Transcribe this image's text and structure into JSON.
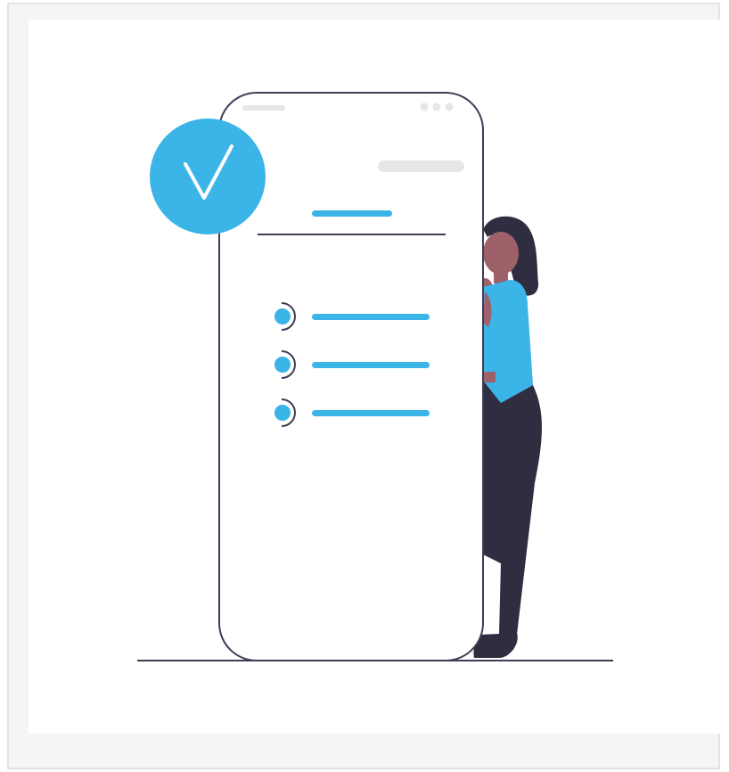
{
  "illustration": {
    "subject": "person-leaning-on-phone-with-checklist",
    "colors": {
      "accent": "#3bb4e7",
      "outline": "#3f3d56",
      "dark": "#2f2e41",
      "skin": "#9e616a",
      "placeholder": "#e6e6e6",
      "frame_bg": "#f5f5f5",
      "card_bg": "#ffffff"
    },
    "checklist_item_count": 3,
    "icons": [
      "check-icon",
      "phone-dots-icon",
      "bullet-icon"
    ]
  }
}
